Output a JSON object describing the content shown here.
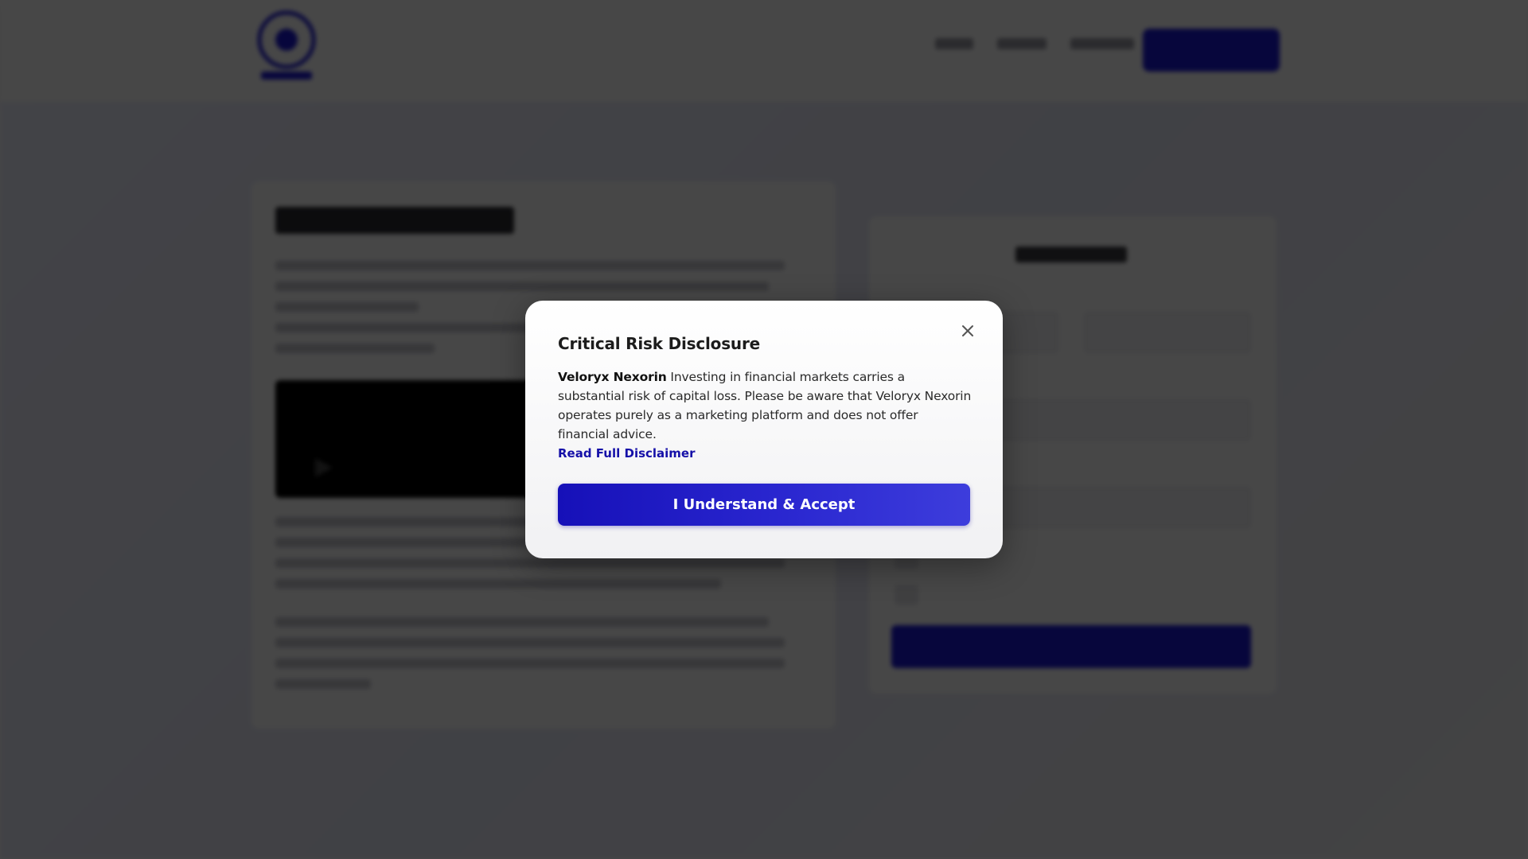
{
  "modal": {
    "title": "Critical Risk Disclosure",
    "body_brand": "Veloryx Nexorin",
    "body_text": " Investing in financial markets carries a substantial risk of capital loss. Please be aware that Veloryx Nexorin operates purely as a marketing platform and does not offer financial advice.",
    "link_label": "Read Full Disclaimer",
    "accept_label": "I Understand & Accept",
    "close_icon": "close-icon"
  },
  "colors": {
    "accent": "#1a17d6",
    "link": "#1510a8",
    "overlay": "rgba(0,0,0,0.72)"
  }
}
